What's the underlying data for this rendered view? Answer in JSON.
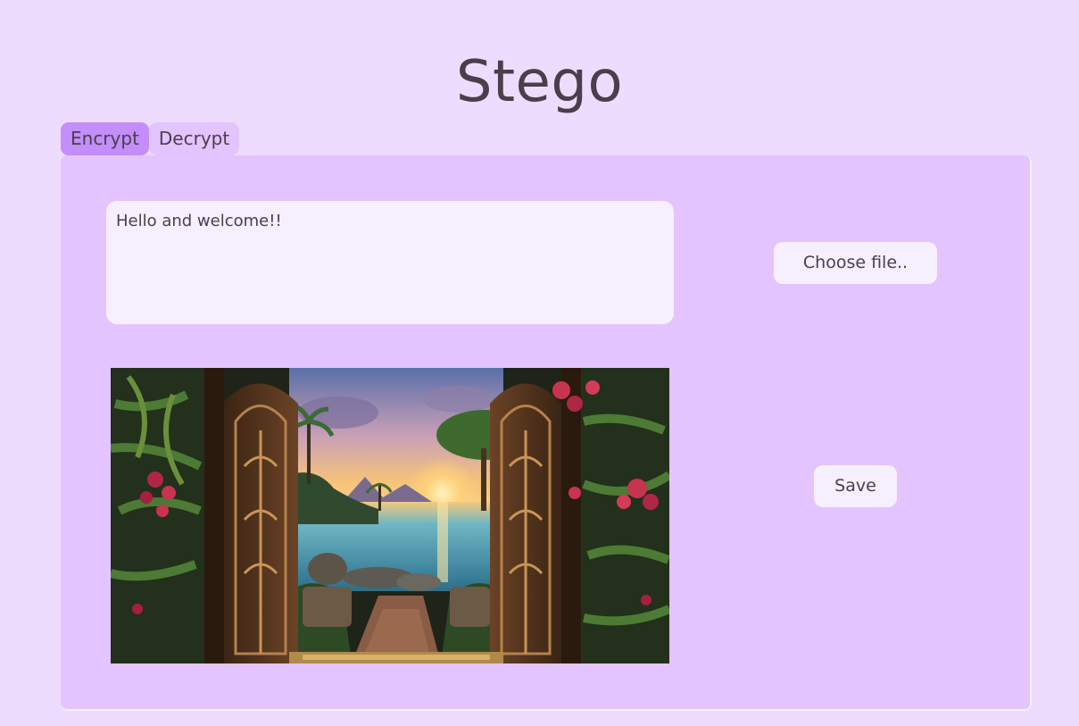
{
  "app": {
    "title": "Stego"
  },
  "tabs": [
    {
      "label": "Encrypt",
      "active": true
    },
    {
      "label": "Decrypt",
      "active": false
    }
  ],
  "encrypt": {
    "message_value": "Hello and welcome!!",
    "choose_file_label": "Choose file..",
    "save_label": "Save",
    "image_description": "fantasy scene: ornate wooden doors opening onto a tropical lagoon at sunset"
  },
  "colors": {
    "page_background": "#eedcff",
    "panel_background": "#e3c4ff",
    "active_tab": "#c38dfa",
    "field_background": "#f6efff",
    "text": "#4a3f4a"
  }
}
